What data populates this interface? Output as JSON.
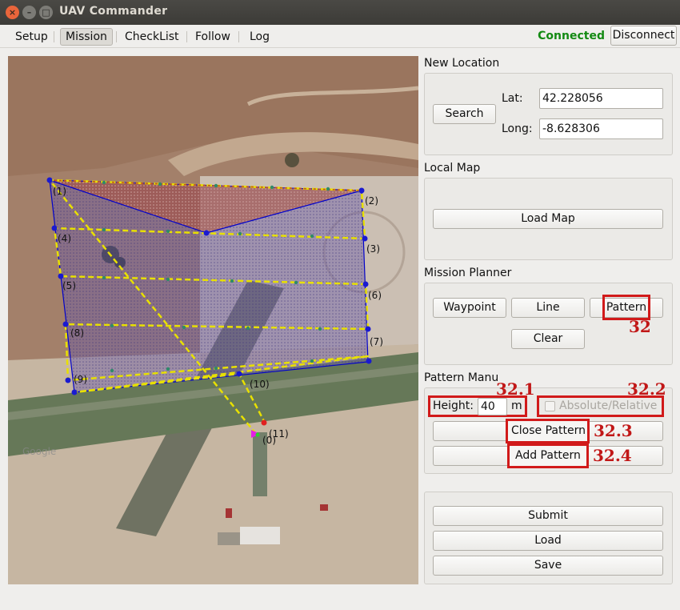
{
  "window": {
    "title": "UAV Commander"
  },
  "menu": {
    "tabs": [
      "Setup",
      "Mission",
      "CheckList",
      "Follow",
      "Log"
    ],
    "active": "Mission"
  },
  "connection": {
    "status": "Connected",
    "disconnect_label": "Disconnect",
    "status_color": "#138a13"
  },
  "new_location": {
    "title": "New Location",
    "search_label": "Search",
    "lat_label": "Lat:",
    "lat_value": "42.228056",
    "long_label": "Long:",
    "long_value": "-8.628306"
  },
  "local_map": {
    "title": "Local Map",
    "load_map_label": "Load Map"
  },
  "mission_planner": {
    "title": "Mission Planner",
    "waypoint_label": "Waypoint",
    "line_label": "Line",
    "pattern_label": "Pattern",
    "clear_label": "Clear"
  },
  "pattern_menu": {
    "title": "Pattern Manu",
    "height_label": "Height:",
    "height_value": "40",
    "height_unit": "m",
    "absolute_relative_label": "Absolute/Relative",
    "absolute_relative_checked": false,
    "close_pattern_label": "Close Pattern",
    "add_pattern_label": "Add Pattern"
  },
  "actions": {
    "submit_label": "Submit",
    "load_label": "Load",
    "save_label": "Save"
  },
  "annotations": {
    "pattern": "32",
    "height": "32.1",
    "absolute": "32.2",
    "close": "32.3",
    "add": "32.4",
    "color": "#c11717"
  },
  "map": {
    "waypoint_labels": [
      "(0)",
      "(1)",
      "(2)",
      "(3)",
      "(4)",
      "(5)",
      "(6)",
      "(7)",
      "(8)",
      "(9)",
      "(10)",
      "(11)"
    ],
    "watermark": "Google",
    "polygon_color": "#0000cc",
    "path_color": "#ffff00"
  }
}
